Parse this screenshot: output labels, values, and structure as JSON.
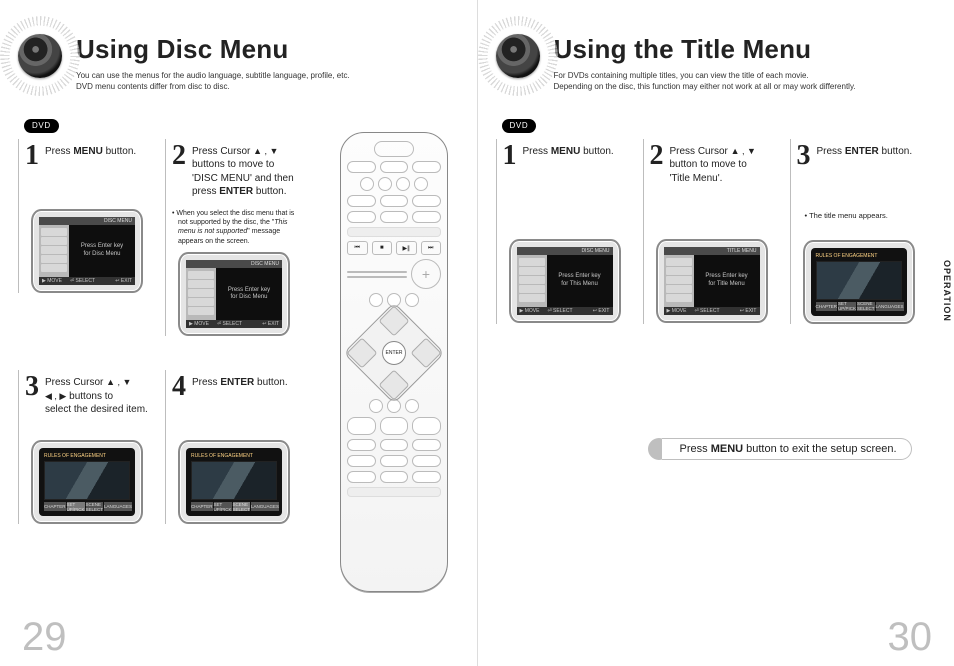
{
  "left": {
    "title": "Using Disc Menu",
    "subtitle": "You can use the menus for the audio language, subtitle language, profile, etc.\nDVD menu contents differ from disc to disc.",
    "dvd_label": "DVD",
    "step1": {
      "num": "1",
      "text_pre": "Press ",
      "text_bold": "MENU",
      "text_post": " button."
    },
    "step2": {
      "num": "2",
      "line1_pre": "Press Cursor ",
      "line1_sym": "▲ , ▼",
      "line2": "buttons to move to",
      "line3_pre": "'DISC MENU' and then press ",
      "line3_bold": "ENTER",
      "line3_post": " button.",
      "note_pre": "When you select the disc menu that is not supported by the disc, the \"",
      "note_quote": "This menu is not supported",
      "note_post": "\" message appears on the screen."
    },
    "step3": {
      "num": "3",
      "line1_pre": "Press Cursor ",
      "line1_sym": "▲ , ▼",
      "line2_sym": "◀ , ▶",
      "line2_post": "  buttons to",
      "line3": "select the desired item."
    },
    "step4": {
      "num": "4",
      "text_pre": "Press ",
      "text_bold": "ENTER",
      "text_post": " button."
    },
    "screens": {
      "menu_topbar_right": "DISC MENU",
      "menu_main_line1": "Press Enter key",
      "menu_main_line2": "for Disc Menu",
      "botbar_a": "▶ MOVE",
      "botbar_b": "⏎ SELECT",
      "botbar_c": "↩ EXIT",
      "movie_title": "RULES OF ENGAGEMENT",
      "tabs": {
        "a": "CHAPTER",
        "b": "SET UP/PICK",
        "c": "SCENE SELECT",
        "d": "LANGUAGES"
      }
    },
    "page_num": "29"
  },
  "right": {
    "title": "Using the Title Menu",
    "subtitle": "For DVDs containing multiple titles, you can view the title of each movie.\nDepending on the disc, this function may either not work at all or may work differently.",
    "dvd_label": "DVD",
    "step1": {
      "num": "1",
      "text_pre": "Press ",
      "text_bold": "MENU",
      "text_post": " button."
    },
    "step2": {
      "num": "2",
      "line1_pre": "Press Cursor ",
      "line1_sym": "▲ , ▼",
      "line2": "button to move to",
      "line3": "'Title Menu'."
    },
    "step3": {
      "num": "3",
      "text_pre": "Press ",
      "text_bold": "ENTER",
      "text_post": " button.",
      "note": "The title menu appears."
    },
    "screens": {
      "menu_topbar_right_a": "DISC MENU",
      "menu_topbar_right_b": "TITLE MENU",
      "menu_main_a1": "Press Enter key",
      "menu_main_a2": "for This Menu",
      "menu_main_b1": "Press Enter key",
      "menu_main_b2": "for Title Menu",
      "movie_title": "RULES OF ENGAGEMENT",
      "tabs": {
        "a": "CHAPTER",
        "b": "SET UP/PICK",
        "c": "SCENE SELECT",
        "d": "LANGUAGES"
      }
    },
    "footnote_pre": "Press ",
    "footnote_bold": "MENU",
    "footnote_post": " button to exit the setup screen.",
    "side_tab": "OPERATION",
    "page_num": "30"
  },
  "remote": {
    "enter": "ENTER"
  }
}
